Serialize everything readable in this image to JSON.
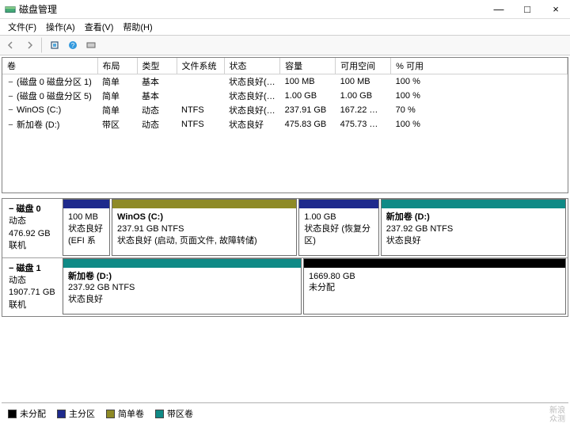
{
  "window": {
    "title": "磁盘管理",
    "min": "—",
    "max": "□",
    "close": "×"
  },
  "menu": {
    "file": "文件(F)",
    "action": "操作(A)",
    "view": "查看(V)",
    "help": "帮助(H)"
  },
  "columns": {
    "volume": "卷",
    "layout": "布局",
    "type": "类型",
    "fs": "文件系统",
    "status": "状态",
    "capacity": "容量",
    "free": "可用空间",
    "pct": "% 可用"
  },
  "rows": [
    {
      "icon": "−",
      "vol": "(磁盘 0 磁盘分区 1)",
      "layout": "简单",
      "type": "基本",
      "fs": "",
      "status": "状态良好(…",
      "cap": "100 MB",
      "free": "100 MB",
      "pct": "100 %"
    },
    {
      "icon": "−",
      "vol": "(磁盘 0 磁盘分区 5)",
      "layout": "简单",
      "type": "基本",
      "fs": "",
      "status": "状态良好(…",
      "cap": "1.00 GB",
      "free": "1.00 GB",
      "pct": "100 %"
    },
    {
      "icon": "−",
      "vol": "WinOS (C:)",
      "layout": "简单",
      "type": "动态",
      "fs": "NTFS",
      "status": "状态良好(…",
      "cap": "237.91 GB",
      "free": "167.22 …",
      "pct": "70 %"
    },
    {
      "icon": "−",
      "vol": "新加卷 (D:)",
      "layout": "带区",
      "type": "动态",
      "fs": "NTFS",
      "status": "状态良好",
      "cap": "475.83 GB",
      "free": "475.73 …",
      "pct": "100 %"
    }
  ],
  "disks": [
    {
      "name": "磁盘 0",
      "kind": "动态",
      "size": "476.92 GB",
      "state": "联机",
      "parts": [
        {
          "flex": 7,
          "color": "c-primary",
          "l1": "",
          "l2": "100 MB",
          "l3": "状态良好 (EFI 系"
        },
        {
          "flex": 28,
          "color": "c-simple",
          "l1": "WinOS  (C:)",
          "l2": "237.91 GB NTFS",
          "l3": "状态良好 (启动, 页面文件, 故障转储)"
        },
        {
          "flex": 12,
          "color": "c-primary",
          "l1": "",
          "l2": "1.00 GB",
          "l3": "状态良好 (恢复分区)"
        },
        {
          "flex": 28,
          "color": "c-stripe",
          "l1": "新加卷  (D:)",
          "l2": "237.92 GB NTFS",
          "l3": "状态良好"
        }
      ]
    },
    {
      "name": "磁盘 1",
      "kind": "动态",
      "size": "1907.71 GB",
      "state": "联机",
      "parts": [
        {
          "flex": 40,
          "color": "c-stripe",
          "l1": "新加卷  (D:)",
          "l2": "237.92 GB NTFS",
          "l3": "状态良好"
        },
        {
          "flex": 44,
          "color": "c-unalloc",
          "l1": "",
          "l2": "1669.80 GB",
          "l3": "未分配"
        }
      ]
    }
  ],
  "legend": {
    "unalloc": "未分配",
    "primary": "主分区",
    "simple": "简单卷",
    "stripe": "带区卷"
  },
  "watermark": {
    "l1": "新浪",
    "l2": "众测"
  }
}
